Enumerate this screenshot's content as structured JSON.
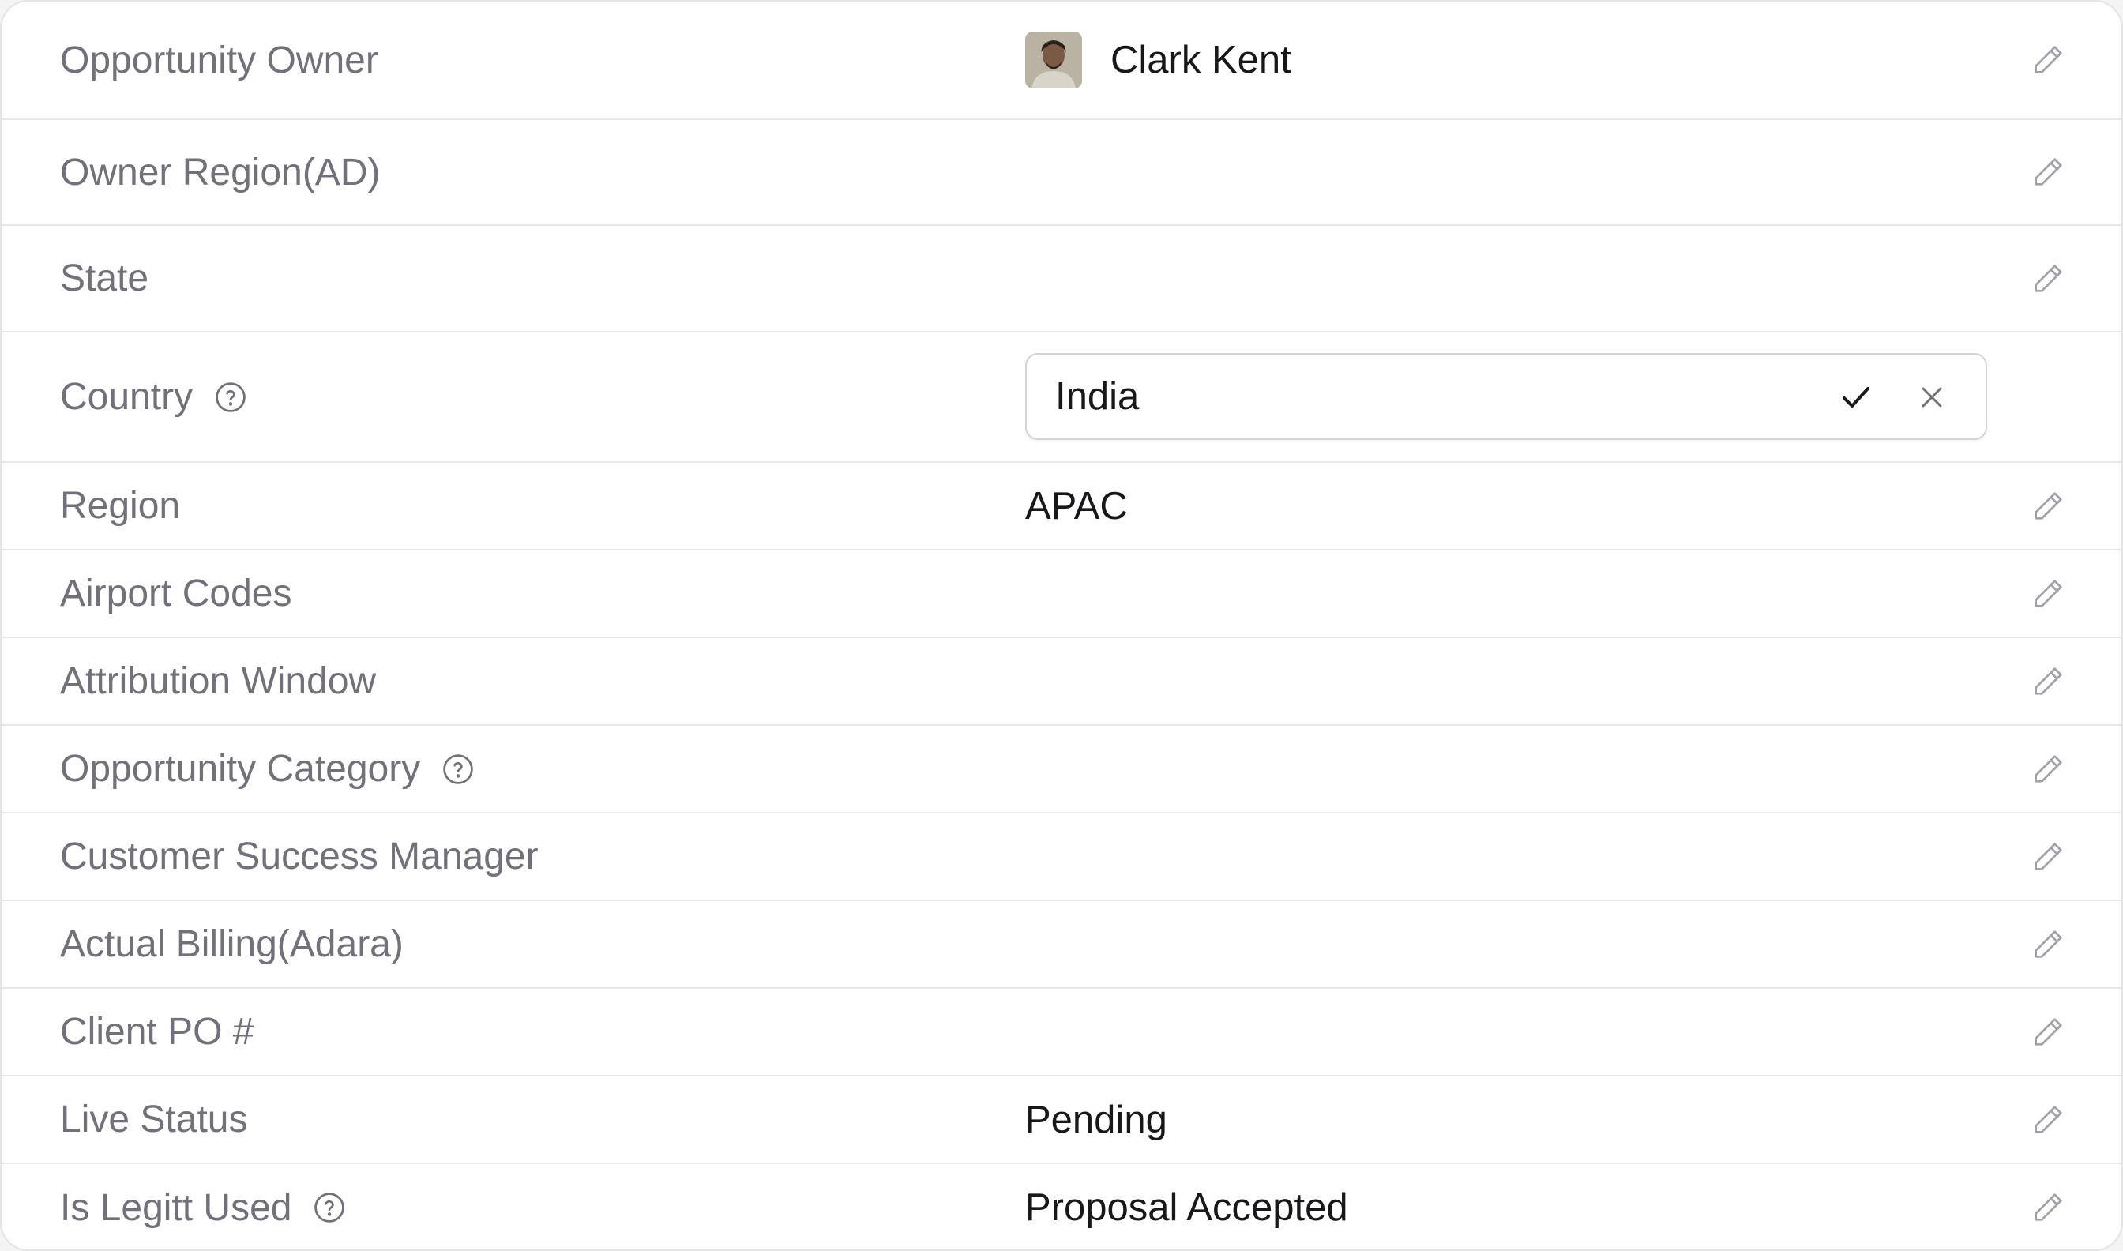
{
  "fields": [
    {
      "label": "Opportunity Owner",
      "value": "Clark Kent"
    },
    {
      "label": "Owner Region(AD)",
      "value": ""
    },
    {
      "label": "State",
      "value": ""
    },
    {
      "label": "Country",
      "value": "India",
      "editing": true
    },
    {
      "label": "Region",
      "value": "APAC"
    },
    {
      "label": "Airport Codes",
      "value": ""
    },
    {
      "label": "Attribution Window",
      "value": ""
    },
    {
      "label": "Opportunity Category",
      "value": ""
    },
    {
      "label": "Customer Success Manager",
      "value": ""
    },
    {
      "label": "Actual Billing(Adara)",
      "value": ""
    },
    {
      "label": "Client PO #",
      "value": ""
    },
    {
      "label": "Live Status",
      "value": "Pending"
    },
    {
      "label": "Is Legitt Used",
      "value": "Proposal Accepted"
    }
  ],
  "icons": {
    "edit": "pencil-icon",
    "help": "help-circle-icon",
    "confirm": "check-icon",
    "cancel": "close-icon"
  },
  "colors": {
    "label": "#71717a",
    "value": "#18181b",
    "divider": "#e8e8ea",
    "icon": "#a1a1aa"
  }
}
